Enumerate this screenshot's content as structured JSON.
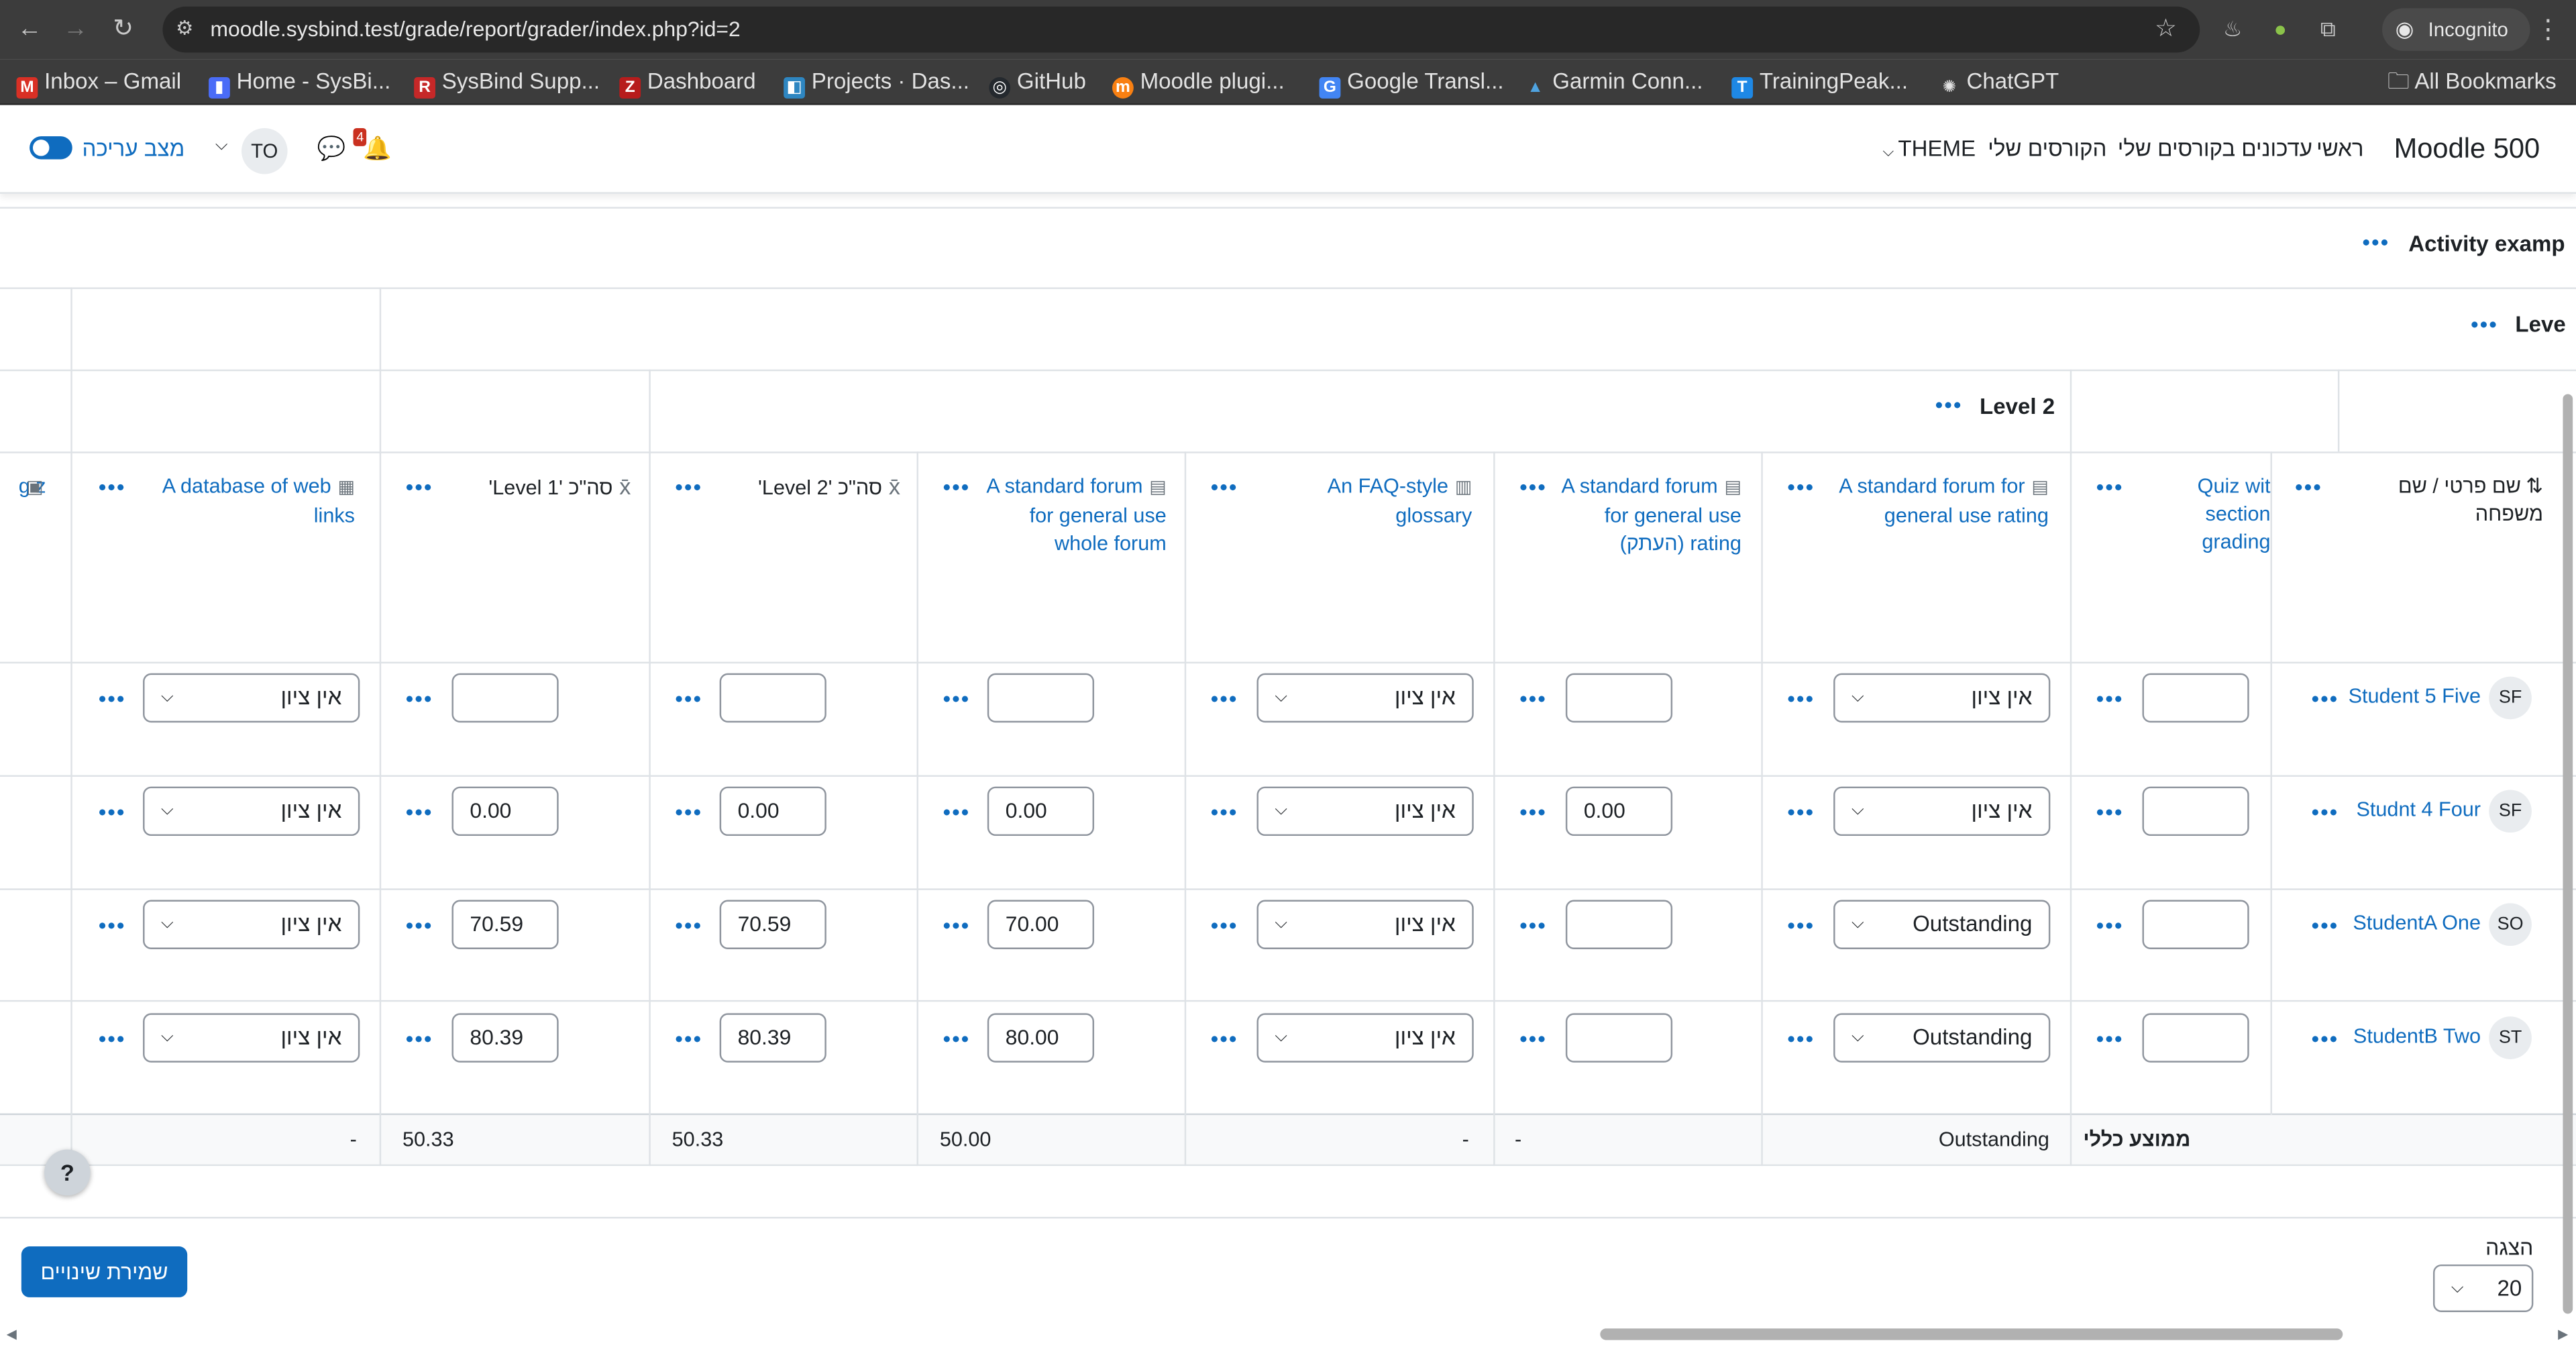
{
  "browser": {
    "url": "moodle.sysbind.test/grade/report/grader/index.php?id=2",
    "incognito_label": "Incognito",
    "bookmarks": [
      "Inbox – Gmail",
      "Home - SysBi...",
      "SysBind Supp...",
      "Dashboard",
      "Projects · Das...",
      "GitHub",
      "Moodle plugi...",
      "Google Transl...",
      "Garmin Conn...",
      "TrainingPeak...",
      "ChatGPT"
    ],
    "all_bookmarks": "All Bookmarks"
  },
  "header": {
    "site_name": "Moodle 500",
    "nav": [
      "ראשי",
      "עדכונים בקורסים שלי",
      "הקורסים שלי",
      "THEME"
    ],
    "edit_mode": "מצב עריכה",
    "user_initials": "TO",
    "notification_count": "4"
  },
  "categories": {
    "activity": "Activity examp",
    "level1": "Leve",
    "level2": "Level 2"
  },
  "columns": {
    "name_header": "שם פרטי / שם משפחה",
    "quiz": "Quiz wit section grading",
    "forum_rating": "A standard forum for general use rating",
    "forum_rating_copy": "A standard forum for general use rating (העתק)",
    "glossary": "An FAQ-style glossary",
    "forum_whole": "A standard forum for general use whole forum",
    "total_level2": "סה\"כ 'Level 2'",
    "total_level1": "סה\"כ 'Level 1'",
    "database": "A database of web links",
    "cut_left": "g z"
  },
  "students": [
    {
      "initials": "SF",
      "name": "Student 5 Five",
      "forum_rating": "אין ציון",
      "forum_rating_copy": "",
      "glossary": "אין ציון",
      "forum_whole": "",
      "total_level2": "",
      "total_level1": "",
      "database": "אין ציון"
    },
    {
      "initials": "SF",
      "name": "Studnt 4 Four",
      "forum_rating": "אין ציון",
      "forum_rating_copy": "0.00",
      "glossary": "אין ציון",
      "forum_whole": "0.00",
      "total_level2": "0.00",
      "total_level1": "0.00",
      "database": "אין ציון"
    },
    {
      "initials": "SO",
      "name": "StudentA One",
      "forum_rating": "Outstanding",
      "forum_rating_copy": "",
      "glossary": "אין ציון",
      "forum_whole": "70.00",
      "total_level2": "70.59",
      "total_level1": "70.59",
      "database": "אין ציון"
    },
    {
      "initials": "ST",
      "name": "StudentB Two",
      "forum_rating": "Outstanding",
      "forum_rating_copy": "",
      "glossary": "אין ציון",
      "forum_whole": "80.00",
      "total_level2": "80.39",
      "total_level1": "80.39",
      "database": "אין ציון"
    }
  ],
  "overall_average": {
    "label": "ממוצע כללי",
    "forum_rating": "Outstanding",
    "forum_rating_copy": "-",
    "glossary": "-",
    "forum_whole": "50.00",
    "total_level2": "50.33",
    "total_level1": "50.33",
    "database": "-"
  },
  "footer": {
    "help": "?",
    "save_button": "שמירת שינויים",
    "show_label": "הצגה",
    "per_page": "20"
  },
  "icons": {
    "dots": "•••",
    "caret": "⌵",
    "sigma": "x̄"
  }
}
